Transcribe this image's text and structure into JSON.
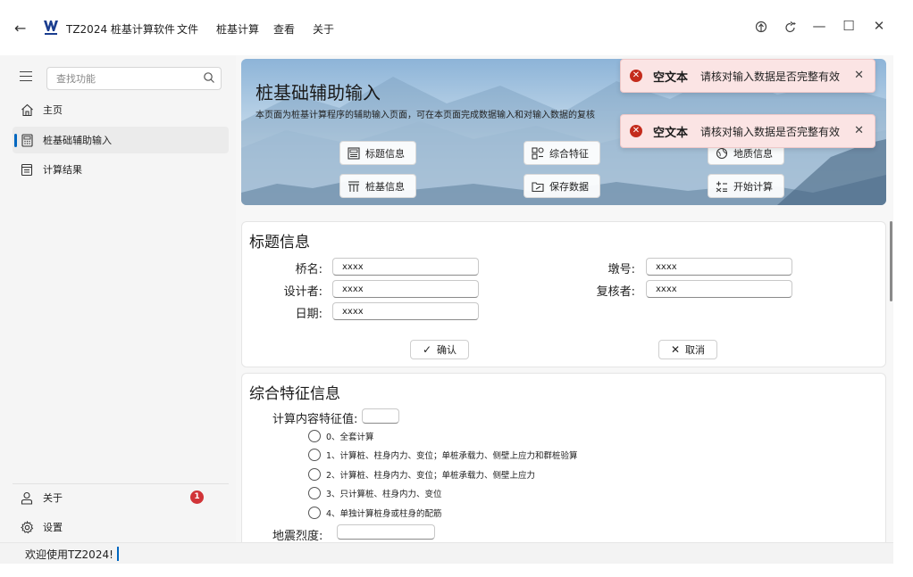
{
  "titlebar": {
    "title": "TZ2024 桩基计算软件",
    "menus": [
      "文件",
      "桩基计算",
      "查看",
      "关于"
    ]
  },
  "sidebar": {
    "search_placeholder": "查找功能",
    "items": [
      {
        "label": "主页",
        "icon": "home-icon"
      },
      {
        "label": "桩基础辅助输入",
        "icon": "calculator-icon",
        "active": true
      },
      {
        "label": "计算结果",
        "icon": "document-icon"
      }
    ],
    "footer_items": [
      {
        "label": "关于",
        "icon": "person-icon",
        "badge": "1"
      },
      {
        "label": "设置",
        "icon": "gear-icon"
      }
    ]
  },
  "banner": {
    "title": "桩基础辅助输入",
    "description": "本页面为桩基计算程序的辅助输入页面，可在本页面完成数据输入和对输入数据的复核",
    "buttons": [
      {
        "label": "标题信息",
        "icon": "title-icon"
      },
      {
        "label": "综合特征",
        "icon": "grid-icon"
      },
      {
        "label": "地质信息",
        "icon": "globe-icon"
      },
      {
        "label": "桩基信息",
        "icon": "pile-icon"
      },
      {
        "label": "保存数据",
        "icon": "save-icon"
      },
      {
        "label": "开始计算",
        "icon": "calc-icon"
      }
    ]
  },
  "title_card": {
    "heading": "标题信息",
    "fields": {
      "bridge_name": {
        "label": "桥名:",
        "value": "xxxx"
      },
      "pier_no": {
        "label": "墩号:",
        "value": "xxxx"
      },
      "designer": {
        "label": "设计者:",
        "value": "xxxx"
      },
      "reviewer": {
        "label": "复核者:",
        "value": "xxxx"
      },
      "date": {
        "label": "日期:",
        "value": "xxxx"
      }
    },
    "confirm_label": "确认",
    "cancel_label": "取消"
  },
  "feature_card": {
    "heading": "综合特征信息",
    "calc_label": "计算内容特征值:",
    "calc_value": "",
    "options": [
      "0、全套计算",
      "1、计算桩、柱身内力、变位；单桩承载力、侧壁上应力和群桩验算",
      "2、计算桩、柱身内力、变位；单桩承载力、侧壁上应力",
      "3、只计算桩、柱身内力、变位",
      "4、单独计算桩身或柱身的配筋"
    ],
    "seismic_label": "地震烈度:",
    "seismic_value": ""
  },
  "toasts": [
    {
      "title": "空文本",
      "message": "请核对输入数据是否完整有效"
    },
    {
      "title": "空文本",
      "message": "请核对输入数据是否完整有效"
    }
  ],
  "statusbar": {
    "text": "欢迎使用TZ2024!"
  },
  "colors": {
    "accent": "#0067c0",
    "error": "#c42b1c",
    "toast_bg": "#fbe4e4",
    "badge": "#d13438"
  }
}
